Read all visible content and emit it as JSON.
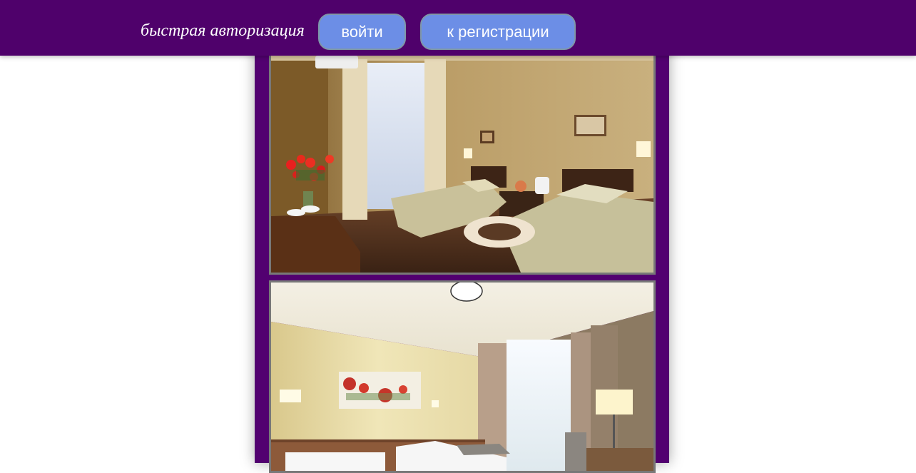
{
  "header": {
    "quick_auth_label": "быстрая авторизация",
    "login_label": "войти",
    "register_label": "к регистрации"
  },
  "colors": {
    "header_bg": "#4f016b",
    "column_bg": "#520070",
    "button_bg": "#6c8ee6"
  },
  "gallery": {
    "images": [
      {
        "subject": "hotel-room-twin-beds-with-red-roses"
      },
      {
        "subject": "hotel-room-with-poppy-painting"
      }
    ]
  }
}
